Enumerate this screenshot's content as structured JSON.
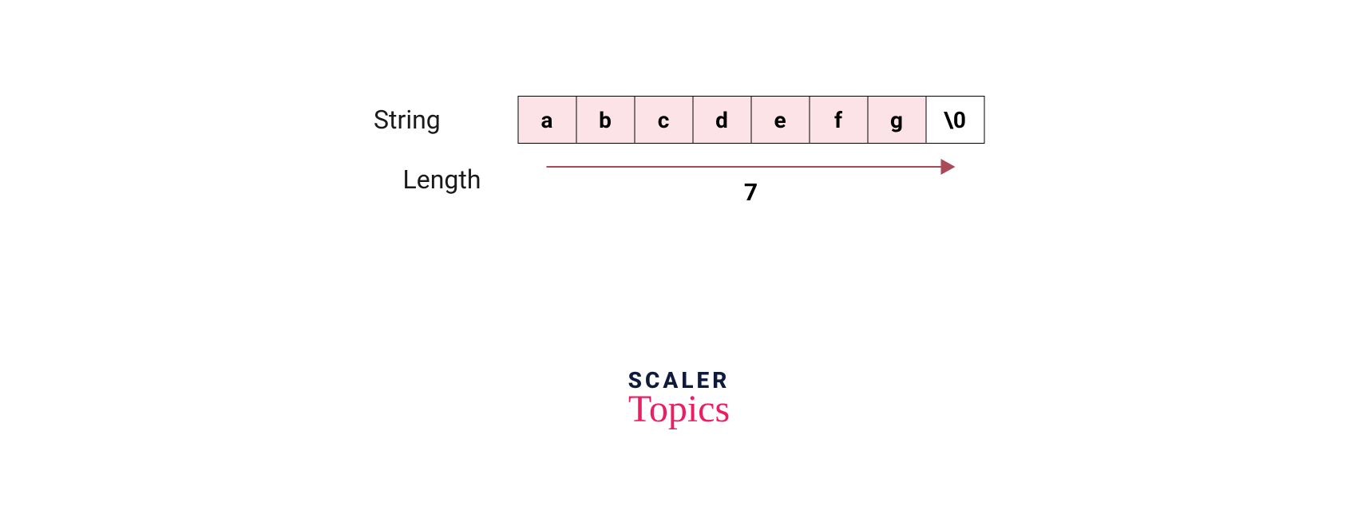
{
  "labels": {
    "string": "String",
    "length": "Length"
  },
  "cells": [
    "a",
    "b",
    "c",
    "d",
    "e",
    "f",
    "g",
    "\\0"
  ],
  "length_value": "7",
  "logo": {
    "top": "SCALER",
    "bottom": "Topics"
  },
  "colors": {
    "cell_fill": "#fce3e8",
    "arrow": "#a94a56",
    "logo_dark": "#0f1b3d",
    "logo_pink": "#e91e63"
  }
}
